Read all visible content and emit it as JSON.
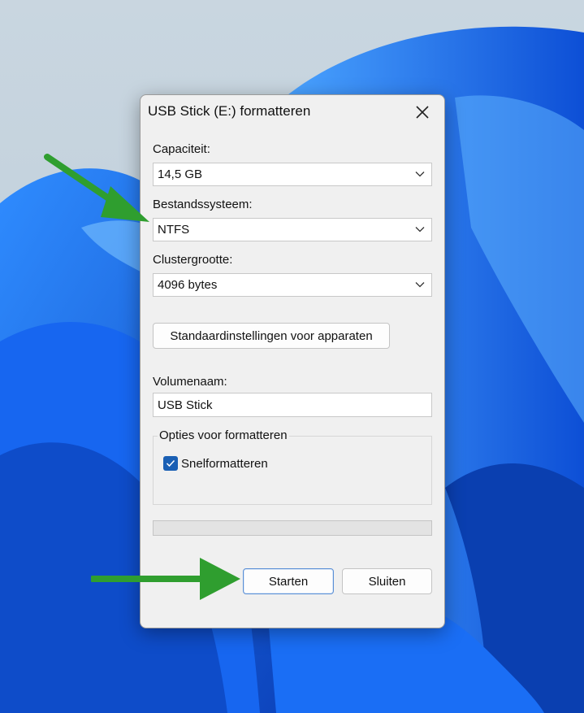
{
  "dialog": {
    "title": "USB Stick (E:) formatteren",
    "close_icon": "close-icon"
  },
  "capacity": {
    "label": "Capaciteit:",
    "value": "14,5 GB"
  },
  "filesystem": {
    "label": "Bestandssysteem:",
    "value": "NTFS"
  },
  "cluster": {
    "label": "Clustergrootte:",
    "value": "4096 bytes"
  },
  "defaults_button": "Standaardinstellingen voor apparaten",
  "volume": {
    "label": "Volumenaam:",
    "value": "USB Stick"
  },
  "options": {
    "label": "Opties voor formatteren",
    "quick_format": {
      "label": "Snelformatteren",
      "checked": true
    }
  },
  "progress": {
    "value": 0
  },
  "buttons": {
    "start": "Starten",
    "close": "Sluiten"
  },
  "colors": {
    "accent": "#1a5fb4",
    "annotation_arrow": "#2f9e2f",
    "wallpaper_blue": "#1565e8"
  }
}
